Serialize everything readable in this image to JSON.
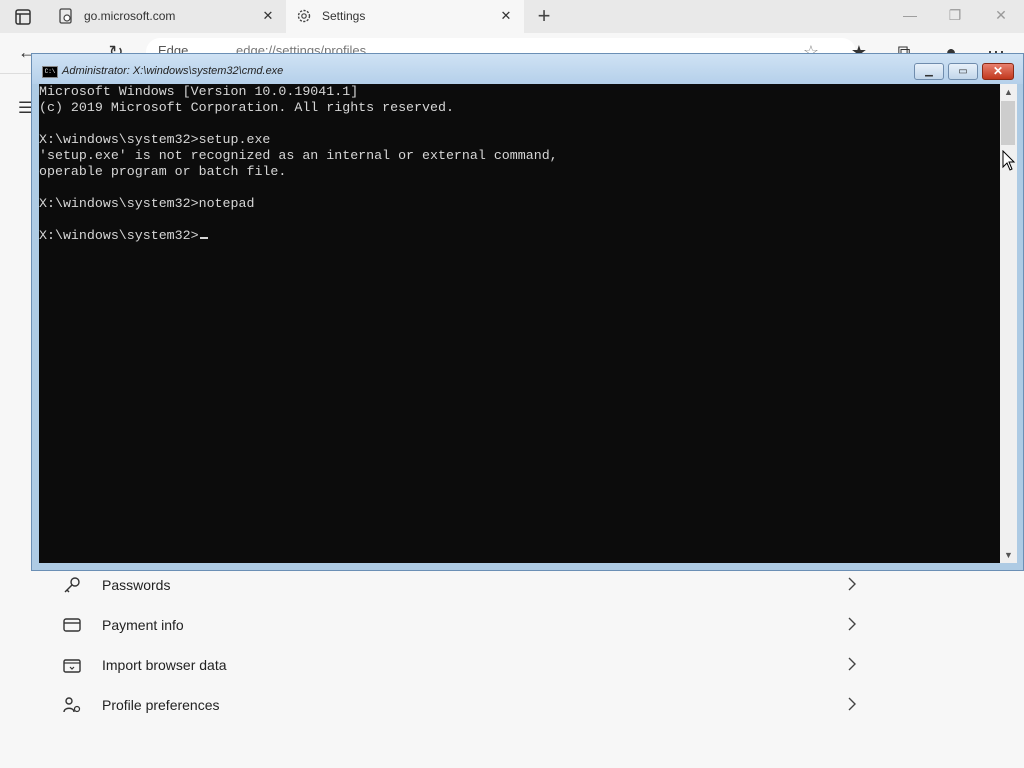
{
  "browser": {
    "tabs": [
      {
        "title": "go.microsoft.com"
      },
      {
        "title": "Settings"
      }
    ],
    "address": {
      "badge": "Edge",
      "url": "edge://settings/profiles"
    }
  },
  "settings": {
    "items": [
      {
        "label": "Passwords",
        "icon": "key-icon"
      },
      {
        "label": "Payment info",
        "icon": "credit-card-icon"
      },
      {
        "label": "Import browser data",
        "icon": "import-icon"
      },
      {
        "label": "Profile preferences",
        "icon": "profile-preferences-icon"
      }
    ]
  },
  "cmd": {
    "title": "Administrator: X:\\windows\\system32\\cmd.exe",
    "icon_text": "C:\\",
    "lines": [
      "Microsoft Windows [Version 10.0.19041.1]",
      "(c) 2019 Microsoft Corporation. All rights reserved.",
      "",
      "X:\\windows\\system32>setup.exe",
      "'setup.exe' is not recognized as an internal or external command,",
      "operable program or batch file.",
      "",
      "X:\\windows\\system32>notepad",
      "",
      "X:\\windows\\system32>"
    ]
  },
  "colors": {
    "console_bg": "#0c0c0c",
    "console_text": "#d6d6d6",
    "cmd_frame": "#aecbe4",
    "close_button": "#c1381e"
  }
}
